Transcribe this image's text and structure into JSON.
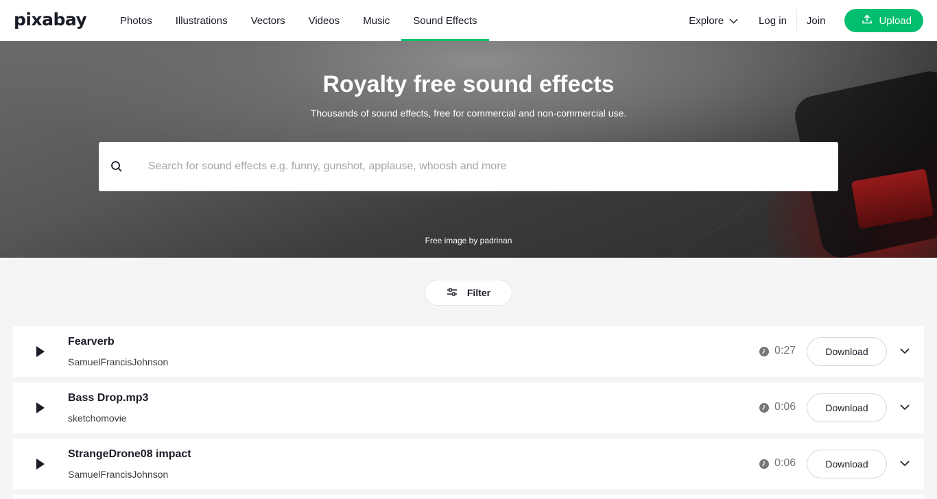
{
  "header": {
    "logo": "pixabay",
    "nav": [
      "Photos",
      "Illustrations",
      "Vectors",
      "Videos",
      "Music",
      "Sound Effects"
    ],
    "active_nav": "Sound Effects",
    "explore": "Explore",
    "login": "Log in",
    "join": "Join",
    "upload": "Upload",
    "accent_color": "#02be6e"
  },
  "hero": {
    "title": "Royalty free sound effects",
    "subtitle": "Thousands of sound effects, free for commercial and non-commercial use.",
    "search_placeholder": "Search for sound effects e.g. funny, gunshot, applause, whoosh and more",
    "credit": "Free image by padrinan"
  },
  "filter": {
    "label": "Filter"
  },
  "tracks": [
    {
      "title": "Fearverb",
      "author": "SamuelFrancisJohnson",
      "duration": "0:27",
      "download": "Download"
    },
    {
      "title": "Bass Drop.mp3",
      "author": "sketchomovie",
      "duration": "0:06",
      "download": "Download"
    },
    {
      "title": "StrangeDrone08 impact",
      "author": "SamuelFrancisJohnson",
      "duration": "0:06",
      "download": "Download"
    }
  ]
}
